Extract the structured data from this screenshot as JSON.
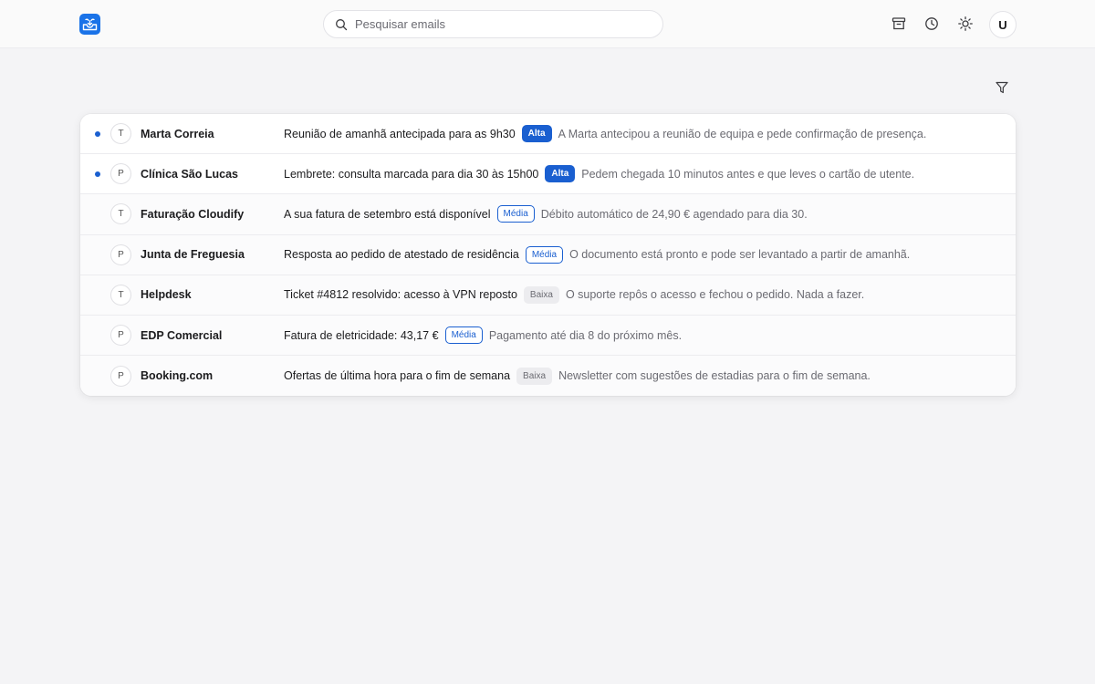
{
  "header": {
    "search_placeholder": "Pesquisar emails",
    "avatar_initial": "U"
  },
  "colors": {
    "accent": "#1a5fd0",
    "logo": "#1a73e8",
    "background": "#f4f4f6"
  },
  "icons": [
    "inbox-logo-icon",
    "search-icon",
    "archive-icon",
    "clock-icon",
    "sun-icon",
    "filter-icon"
  ],
  "emails": [
    {
      "initial": "T",
      "sender": "Marta Correia",
      "subject": "Reunião de amanhã antecipada para as 9h30",
      "priority": "Alta",
      "priority_level": "alta",
      "preview": "A Marta antecipou a reunião de equipa e pede confirmação de presença.",
      "unread": true
    },
    {
      "initial": "P",
      "sender": "Clínica São Lucas",
      "subject": "Lembrete: consulta marcada para dia 30 às 15h00",
      "priority": "Alta",
      "priority_level": "alta",
      "preview": "Pedem chegada 10 minutos antes e que leves o cartão de utente.",
      "unread": true
    },
    {
      "initial": "T",
      "sender": "Faturação Cloudify",
      "subject": "A sua fatura de setembro está disponível",
      "priority": "Média",
      "priority_level": "media",
      "preview": "Débito automático de 24,90 € agendado para dia 30.",
      "unread": false
    },
    {
      "initial": "P",
      "sender": "Junta de Freguesia",
      "subject": "Resposta ao pedido de atestado de residência",
      "priority": "Média",
      "priority_level": "media",
      "preview": "O documento está pronto e pode ser levantado a partir de amanhã.",
      "unread": false
    },
    {
      "initial": "T",
      "sender": "Helpdesk",
      "subject": "Ticket #4812 resolvido: acesso à VPN reposto",
      "priority": "Baixa",
      "priority_level": "baixa",
      "preview": "O suporte repôs o acesso e fechou o pedido. Nada a fazer.",
      "unread": false
    },
    {
      "initial": "P",
      "sender": "EDP Comercial",
      "subject": "Fatura de eletricidade: 43,17 €",
      "priority": "Média",
      "priority_level": "media",
      "preview": "Pagamento até dia 8 do próximo mês.",
      "unread": false
    },
    {
      "initial": "P",
      "sender": "Booking.com",
      "subject": "Ofertas de última hora para o fim de semana",
      "priority": "Baixa",
      "priority_level": "baixa",
      "preview": "Newsletter com sugestões de estadias para o fim de semana.",
      "unread": false
    }
  ]
}
